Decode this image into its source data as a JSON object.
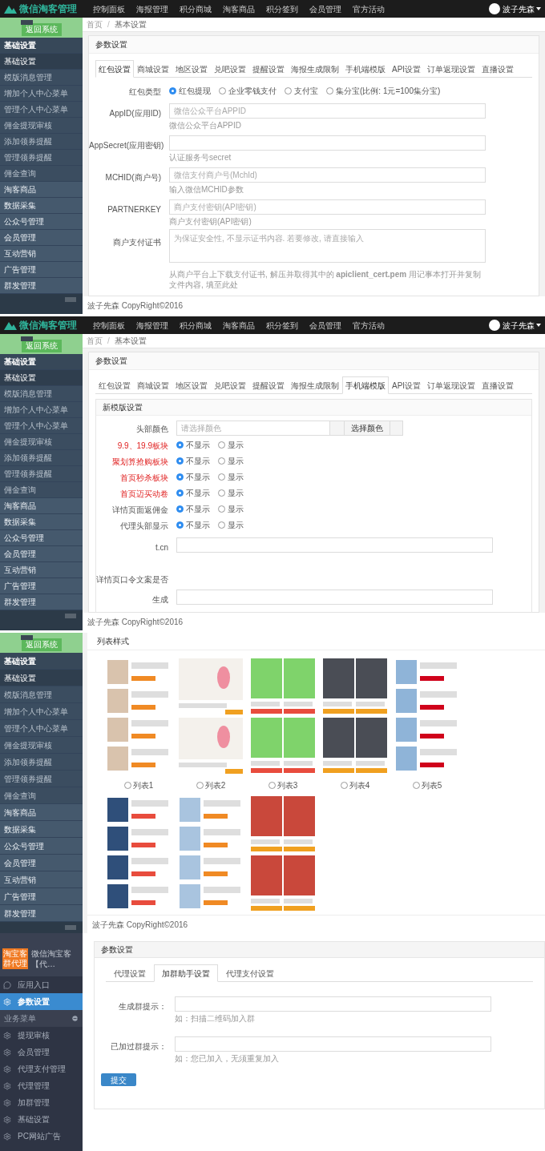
{
  "screens": [
    {
      "kind": "basic-settings",
      "navbar": {
        "brand": "微信淘客管理",
        "items": [
          "控制面板",
          "海报管理",
          "积分商城",
          "淘客商品",
          "积分签到",
          "会员管理",
          "官方活动"
        ],
        "user": "波子先森"
      },
      "sidebar": {
        "back_button": "返回系统",
        "items": [
          {
            "kind": "header",
            "label": "基础设置",
            "selected": false
          },
          {
            "kind": "item",
            "label": "基础设置",
            "selected": true
          },
          {
            "kind": "item",
            "label": "模版消息管理",
            "selected": false
          },
          {
            "kind": "item",
            "label": "增加个人中心菜单",
            "selected": false
          },
          {
            "kind": "item",
            "label": "管理个人中心菜单",
            "selected": false
          },
          {
            "kind": "item",
            "label": "佣金提现审核",
            "selected": false
          },
          {
            "kind": "item",
            "label": "添加领券提醒",
            "selected": false
          },
          {
            "kind": "item",
            "label": "管理领券提醒",
            "selected": false
          },
          {
            "kind": "item",
            "label": "佣金查询",
            "selected": false
          },
          {
            "kind": "group",
            "label": "淘客商品",
            "selected": false
          },
          {
            "kind": "group",
            "label": "数据采集",
            "selected": false
          },
          {
            "kind": "group",
            "label": "公众号管理",
            "selected": false
          },
          {
            "kind": "group",
            "label": "会员管理",
            "selected": false
          },
          {
            "kind": "group",
            "label": "互动营销",
            "selected": false
          },
          {
            "kind": "group",
            "label": "广告管理",
            "selected": false
          },
          {
            "kind": "group",
            "label": "群发管理",
            "selected": false
          }
        ]
      },
      "breadcrumb": {
        "home": "首页",
        "separator": "/",
        "current": "基本设置"
      },
      "panel_title": "参数设置",
      "tabs": [
        {
          "label": "红包设置",
          "selected": true
        },
        {
          "label": "商城设置",
          "selected": false
        },
        {
          "label": "地区设置",
          "selected": false
        },
        {
          "label": "兑吧设置",
          "selected": false
        },
        {
          "label": "提醒设置",
          "selected": false
        },
        {
          "label": "海报生成限制",
          "selected": false
        },
        {
          "label": "手机端模版",
          "selected": false
        },
        {
          "label": "API设置",
          "selected": false
        },
        {
          "label": "订单返现设置",
          "selected": false
        },
        {
          "label": "直播设置",
          "selected": false
        }
      ],
      "rows": [
        {
          "kind": "radio",
          "label": "红包类型",
          "options": [
            {
              "label": "红包提现",
              "selected": true
            },
            {
              "label": "企业零钱支付",
              "selected": false
            },
            {
              "label": "支付宝",
              "selected": false
            },
            {
              "label": "集分宝(比例: 1元=100集分宝)",
              "selected": false
            }
          ]
        },
        {
          "kind": "input",
          "label": "AppID(应用ID)",
          "placeholder": "微信公众平台APPID",
          "help": "微信公众平台APPID"
        },
        {
          "kind": "input",
          "label": "AppSecret(应用密钥)",
          "help": "认证服务号secret"
        },
        {
          "kind": "input",
          "label": "MCHID(商户号)",
          "placeholder": "微信支付商户号(MchId)",
          "help": "输入微信MCHID参数"
        },
        {
          "kind": "input",
          "label": "PARTNERKEY",
          "placeholder": "商户支付密钥(API密钥)",
          "help": "商户支付密钥(API密钥)"
        },
        {
          "kind": "textarea",
          "label": "商户支付证书",
          "placeholder": "为保证安全性, 不显示证书内容. 若要修改, 请直接输入",
          "help": "从商户平台上下载支付证书, 解压并取得其中的 **apiclient_cert.pem** 用记事本打开并复制文件内容, 填至此处"
        }
      ],
      "footer": "波子先森 CopyRight©2016"
    },
    {
      "kind": "template-settings",
      "navbar": {
        "brand": "微信淘客管理",
        "items": [
          "控制面板",
          "海报管理",
          "积分商城",
          "淘客商品",
          "积分签到",
          "会员管理",
          "官方活动"
        ],
        "user": "波子先森"
      },
      "sidebar": {
        "back_button": "返回系统",
        "items": [
          {
            "kind": "header",
            "label": "基础设置",
            "selected": false
          },
          {
            "kind": "item",
            "label": "基础设置",
            "selected": true
          },
          {
            "kind": "item",
            "label": "模版消息管理",
            "selected": false
          },
          {
            "kind": "item",
            "label": "增加个人中心菜单",
            "selected": false
          },
          {
            "kind": "item",
            "label": "管理个人中心菜单",
            "selected": false
          },
          {
            "kind": "item",
            "label": "佣金提现审核",
            "selected": false
          },
          {
            "kind": "item",
            "label": "添加领券提醒",
            "selected": false
          },
          {
            "kind": "item",
            "label": "管理领券提醒",
            "selected": false
          },
          {
            "kind": "item",
            "label": "佣金查询",
            "selected": false
          },
          {
            "kind": "group",
            "label": "淘客商品",
            "selected": false
          },
          {
            "kind": "group",
            "label": "数据采集",
            "selected": false
          },
          {
            "kind": "group",
            "label": "公众号管理",
            "selected": false
          },
          {
            "kind": "group",
            "label": "会员管理",
            "selected": false
          },
          {
            "kind": "group",
            "label": "互动营销",
            "selected": false
          },
          {
            "kind": "group",
            "label": "广告管理",
            "selected": false
          },
          {
            "kind": "group",
            "label": "群发管理",
            "selected": false
          }
        ]
      },
      "breadcrumb": {
        "home": "首页",
        "separator": "/",
        "current": "基本设置"
      },
      "panel_title": "参数设置",
      "tabs": [
        {
          "label": "红包设置",
          "selected": false
        },
        {
          "label": "商城设置",
          "selected": false
        },
        {
          "label": "地区设置",
          "selected": false
        },
        {
          "label": "兑吧设置",
          "selected": false
        },
        {
          "label": "提醒设置",
          "selected": false
        },
        {
          "label": "海报生成限制",
          "selected": false
        },
        {
          "label": "手机端模版",
          "selected": true
        },
        {
          "label": "API设置",
          "selected": false
        },
        {
          "label": "订单返现设置",
          "selected": false
        },
        {
          "label": "直播设置",
          "selected": false
        }
      ],
      "subpanel_title": "新模版设置",
      "rows": [
        {
          "kind": "color",
          "label": "头部颜色",
          "placeholder": "请选择颜色",
          "button": "选择颜色"
        },
        {
          "kind": "radio",
          "label": "9.9、19.9板块",
          "emphasis": true,
          "options": [
            {
              "label": "不显示",
              "selected": true
            },
            {
              "label": "显示",
              "selected": false
            }
          ]
        },
        {
          "kind": "radio",
          "label": "聚划算抢购板块",
          "emphasis": true,
          "options": [
            {
              "label": "不显示",
              "selected": true
            },
            {
              "label": "显示",
              "selected": false
            }
          ]
        },
        {
          "kind": "radio",
          "label": "首页秒杀板块",
          "emphasis": true,
          "options": [
            {
              "label": "不显示",
              "selected": true
            },
            {
              "label": "显示",
              "selected": false
            }
          ]
        },
        {
          "kind": "radio",
          "label": "首页迈买动卷",
          "emphasis": true,
          "options": [
            {
              "label": "不显示",
              "selected": true
            },
            {
              "label": "显示",
              "selected": false
            }
          ]
        },
        {
          "kind": "radio",
          "label": "详情页面返佣金",
          "emphasis": false,
          "options": [
            {
              "label": "不显示",
              "selected": true
            },
            {
              "label": "显示",
              "selected": false
            }
          ]
        },
        {
          "kind": "radio",
          "label": "代理头部显示",
          "emphasis": false,
          "options": [
            {
              "label": "不显示",
              "selected": true
            },
            {
              "label": "显示",
              "selected": false
            }
          ]
        },
        {
          "kind": "input",
          "label": "t.cn"
        },
        {
          "kind": "label",
          "label": "详情页口令文案是否"
        },
        {
          "kind": "input",
          "label": "生成"
        }
      ],
      "footer": "波子先森 CopyRight©2016"
    },
    {
      "kind": "list-style",
      "sidebar": {
        "back_button": "返回系统",
        "items": [
          {
            "kind": "header",
            "label": "基础设置",
            "selected": false
          },
          {
            "kind": "item",
            "label": "基础设置",
            "selected": true
          },
          {
            "kind": "item",
            "label": "模版消息管理",
            "selected": false
          },
          {
            "kind": "item",
            "label": "增加个人中心菜单",
            "selected": false
          },
          {
            "kind": "item",
            "label": "管理个人中心菜单",
            "selected": false
          },
          {
            "kind": "item",
            "label": "佣金提现审核",
            "selected": false
          },
          {
            "kind": "item",
            "label": "添加领券提醒",
            "selected": false
          },
          {
            "kind": "item",
            "label": "管理领券提醒",
            "selected": false
          },
          {
            "kind": "item",
            "label": "佣金查询",
            "selected": false
          },
          {
            "kind": "group",
            "label": "淘客商品",
            "selected": false
          },
          {
            "kind": "group",
            "label": "数据采集",
            "selected": false
          },
          {
            "kind": "group",
            "label": "公众号管理",
            "selected": false
          },
          {
            "kind": "group",
            "label": "会员管理",
            "selected": false
          },
          {
            "kind": "group",
            "label": "互动营销",
            "selected": false
          },
          {
            "kind": "group",
            "label": "广告管理",
            "selected": false
          },
          {
            "kind": "group",
            "label": "群发管理",
            "selected": false
          }
        ]
      },
      "section_title": "列表样式",
      "list_styles": [
        {
          "label": "列表1",
          "selected": false
        },
        {
          "label": "列表2",
          "selected": false
        },
        {
          "label": "列表3",
          "selected": false
        },
        {
          "label": "列表4",
          "selected": false
        },
        {
          "label": "列表5",
          "selected": false
        }
      ],
      "more_styles": [
        {
          "kind": "picture"
        },
        {
          "kind": "picture"
        },
        {
          "kind": "picture"
        }
      ],
      "footer": "波子先森 CopyRight©2016"
    },
    {
      "kind": "agent-settings",
      "sidebar": {
        "logo": "淘宝客群代理",
        "title": "微信淘宝客【代…",
        "items": [
          {
            "kind": "app-entry",
            "label": "应用入口",
            "selected": false
          },
          {
            "kind": "menu-entry",
            "label": "参数设置",
            "selected": true
          },
          {
            "kind": "section",
            "label": "业务菜单"
          },
          {
            "kind": "menu-entry",
            "label": "提现审核",
            "selected": false
          },
          {
            "kind": "menu-entry",
            "label": "会员管理",
            "selected": false
          },
          {
            "kind": "menu-entry",
            "label": "代理支付管理",
            "selected": false
          },
          {
            "kind": "menu-entry",
            "label": "代理管理",
            "selected": false
          },
          {
            "kind": "menu-entry",
            "label": "加群管理",
            "selected": false
          },
          {
            "kind": "menu-entry",
            "label": "基础设置",
            "selected": false
          },
          {
            "kind": "menu-entry",
            "label": "PC网站广告",
            "selected": false
          }
        ]
      },
      "panel_title": "参数设置",
      "tabs": [
        {
          "label": "代理设置",
          "selected": false
        },
        {
          "label": "加群助手设置",
          "selected": true
        },
        {
          "label": "代理支付设置",
          "selected": false
        }
      ],
      "rows": [
        {
          "kind": "input",
          "label": "生成群提示：",
          "help": "如：扫描二维码加入群"
        },
        {
          "kind": "input",
          "label": "已加过群提示：",
          "help": "如：您已加入，无须重复加入"
        }
      ],
      "submit": "提交"
    }
  ]
}
